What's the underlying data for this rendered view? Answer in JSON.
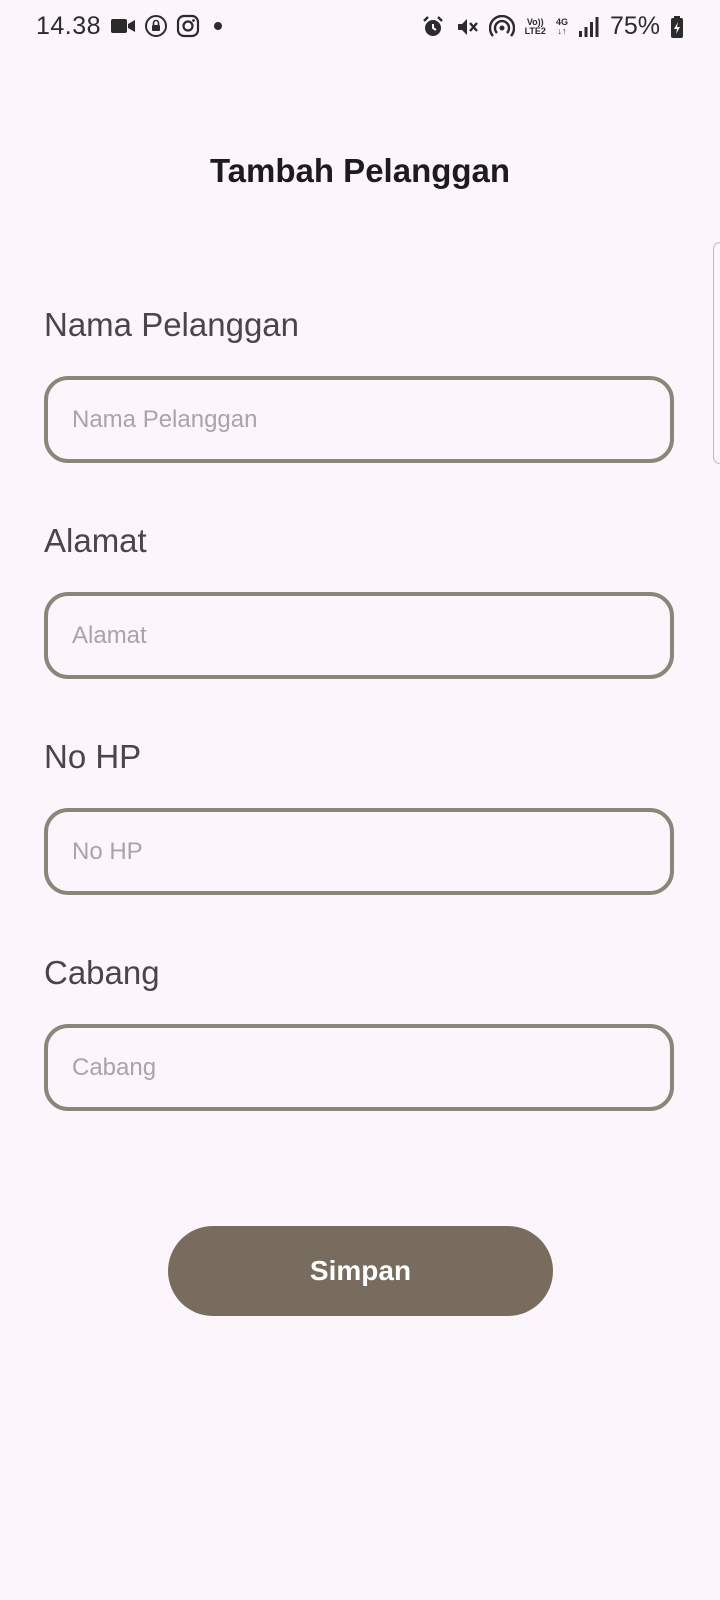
{
  "status_bar": {
    "time": "14.38",
    "battery": "75%",
    "volte_label": "Vo))",
    "lte_label": "LTE2",
    "network_label": "4G",
    "icons_left": [
      "video-camera-icon",
      "lock-circle-icon",
      "instagram-icon",
      "notification-dot-icon"
    ],
    "icons_right": [
      "alarm-icon",
      "mute-icon",
      "hotspot-icon",
      "volte-icon",
      "4g-icon",
      "signal-icon",
      "battery-icon"
    ]
  },
  "header": {
    "title": "Tambah Pelanggan"
  },
  "form": {
    "fields": [
      {
        "label": "Nama Pelanggan",
        "placeholder": "Nama Pelanggan",
        "value": ""
      },
      {
        "label": "Alamat",
        "placeholder": "Alamat",
        "value": ""
      },
      {
        "label": "No HP",
        "placeholder": "No HP",
        "value": ""
      },
      {
        "label": "Cabang",
        "placeholder": "Cabang",
        "value": ""
      }
    ],
    "submit_label": "Simpan"
  },
  "colors": {
    "background": "#fcf5fb",
    "field_border": "#8d8577",
    "button_bg": "#776c5e",
    "button_text": "#ffffff",
    "label_text": "#4a4548",
    "placeholder_text": "#aaa4a9"
  }
}
